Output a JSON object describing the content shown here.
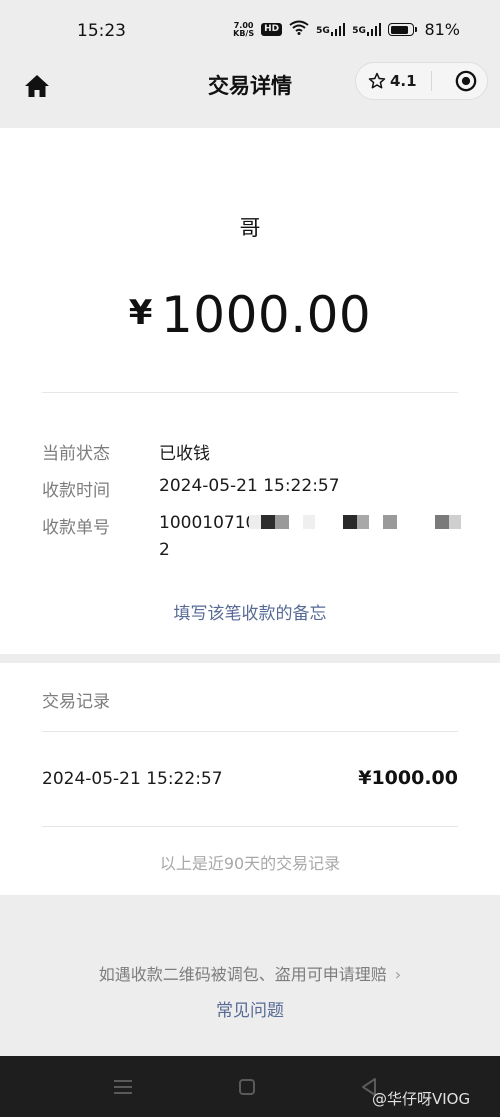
{
  "status_bar": {
    "time": "15:23",
    "net_speed_value": "7.00",
    "net_speed_unit": "KB/S",
    "hd_badge": "HD",
    "signal_1": "5G",
    "signal_2": "5G",
    "battery": "81%"
  },
  "nav": {
    "title": "交易详情",
    "rating": "4.1"
  },
  "detail": {
    "payee": "哥",
    "currency_symbol": "¥",
    "amount": "1000.00",
    "rows": [
      {
        "label": "当前状态",
        "value": "已收钱"
      },
      {
        "label": "收款时间",
        "value": "2024-05-21 15:22:57"
      },
      {
        "label": "收款单号",
        "value": "1000107101",
        "value_line2": "2"
      }
    ],
    "remark_link": "填写该笔收款的备忘"
  },
  "records": {
    "title": "交易记录",
    "items": [
      {
        "time": "2024-05-21 15:22:57",
        "amount": "¥1000.00"
      }
    ],
    "note": "以上是近90天的交易记录"
  },
  "footer": {
    "notice": "如遇收款二维码被调包、盗用可申请理赔",
    "faq_link": "常见问题"
  },
  "watermark": "@华仔呀VIOG"
}
